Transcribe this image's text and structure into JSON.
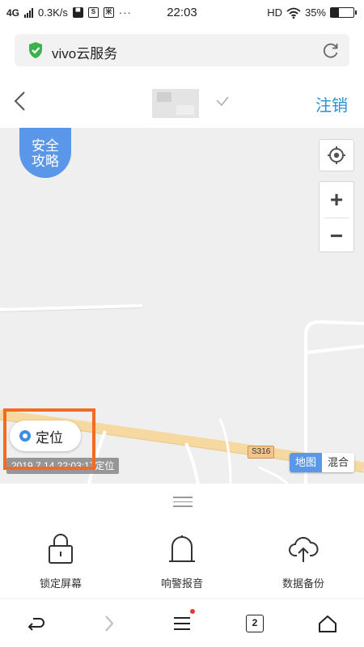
{
  "status_bar": {
    "network": "4G",
    "speed": "0.3K/s",
    "icon_s": "S",
    "icon_fan": "米",
    "dots": "···",
    "time": "22:03",
    "hd": "HD",
    "battery": "35%",
    "battery_level": 0.35
  },
  "browser": {
    "url_text": "vivo云服务"
  },
  "header": {
    "logout_label": "注销"
  },
  "map": {
    "safe_badge": "安全攻略",
    "safe_badge_line1": "安全",
    "safe_badge_line2": "攻略",
    "zoom_in": "+",
    "zoom_out": "−",
    "locate_label": "定位",
    "locate_time": "2019.7.14 22:03:17定位",
    "road_label": "S316",
    "map_type_options": [
      "地图",
      "混合"
    ],
    "map_type_selected": "地图"
  },
  "actions": [
    {
      "label": "锁定屏幕",
      "icon": "lock-icon"
    },
    {
      "label": "响警报音",
      "icon": "bell-icon"
    },
    {
      "label": "数据备份",
      "icon": "cloud-upload-icon"
    }
  ],
  "nav": {
    "tab_count": "2"
  },
  "colors": {
    "accent": "#2a90d8",
    "badge": "#5b97e8",
    "highlight": "#f36b21",
    "road": "#f5d9a0",
    "shield": "#3cb34a"
  }
}
